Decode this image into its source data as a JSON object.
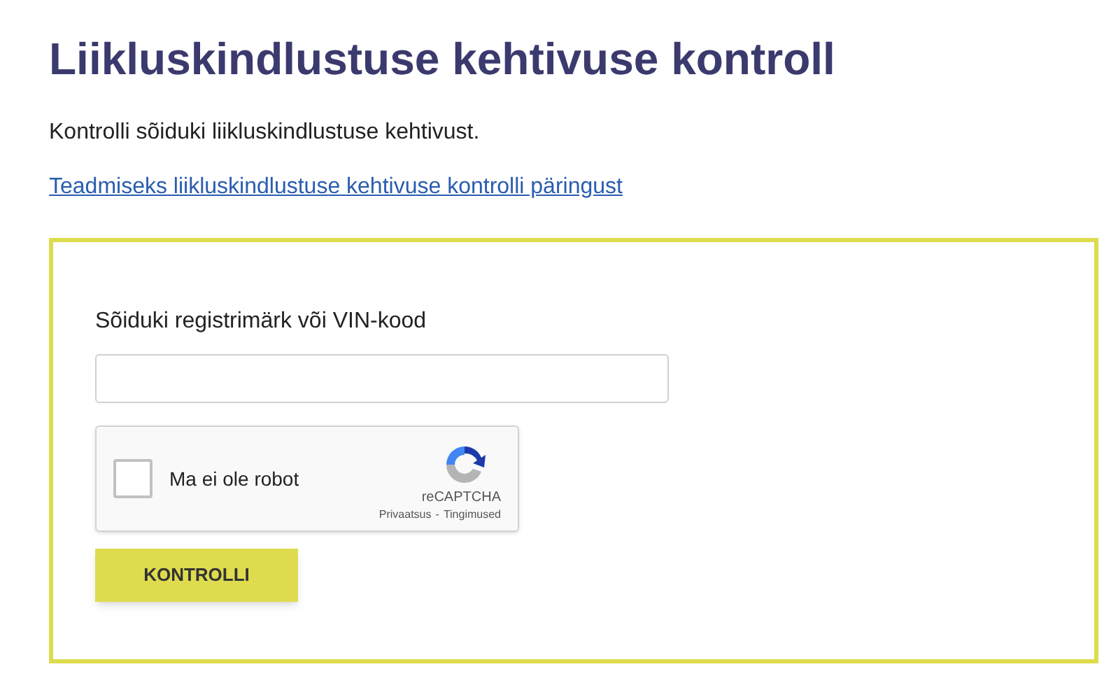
{
  "title": "Liikluskindlustuse kehtivuse kontroll",
  "intro": "Kontrolli sõiduki liikluskindlustuse kehtivust.",
  "info_link": "Teadmiseks liikluskindlustuse kehtivuse kontrolli päringust",
  "form": {
    "field_label": "Sõiduki registrimärk või VIN-kood",
    "captcha": {
      "label": "Ma ei ole robot",
      "checked": false,
      "brand": "reCAPTCHA",
      "links": [
        "Privaatsus",
        "Tingimused"
      ],
      "separator": "-"
    },
    "submit": "KONTROLLI"
  }
}
